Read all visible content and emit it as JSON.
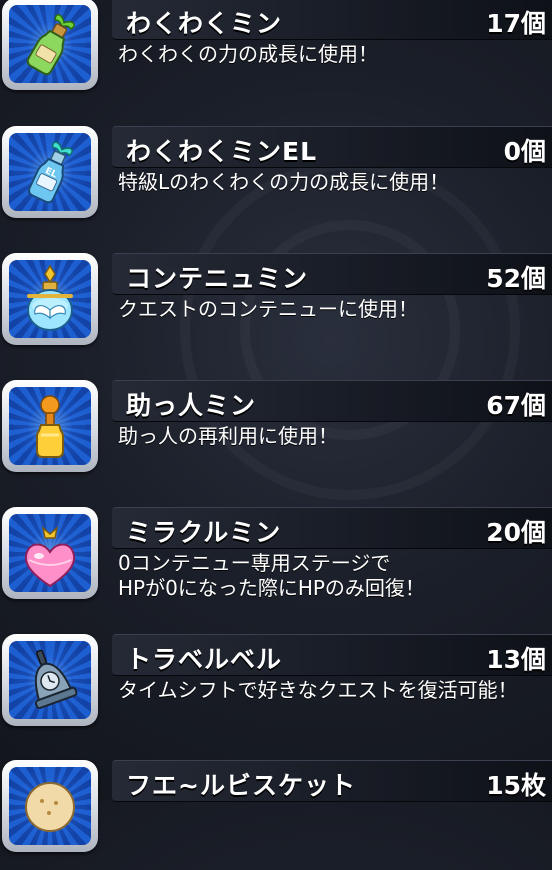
{
  "items": [
    {
      "name": "わくわくミン",
      "count": "17個",
      "desc": [
        "わくわくの力の成長に使用！"
      ],
      "icon": "green-bottle-icon"
    },
    {
      "name": "わくわくミンEL",
      "count": "0個",
      "desc": [
        "特級Lのわくわくの力の成長に使用！"
      ],
      "icon": "el-bottle-icon"
    },
    {
      "name": "コンテニュミン",
      "count": "52個",
      "desc": [
        "クエストのコンテニューに使用！"
      ],
      "icon": "winged-potion-icon"
    },
    {
      "name": "助っ人ミン",
      "count": "67個",
      "desc": [
        "助っ人の再利用に使用！"
      ],
      "icon": "orange-bottle-icon"
    },
    {
      "name": "ミラクルミン",
      "count": "20個",
      "desc": [
        "0コンテニュー専用ステージで",
        "HPが0になった際にHPのみ回復！"
      ],
      "icon": "heart-potion-icon"
    },
    {
      "name": "トラベルベル",
      "count": "13個",
      "desc": [
        "タイムシフトで好きなクエストを復活可能！"
      ],
      "icon": "bell-icon"
    },
    {
      "name": "フエ~ルビスケット",
      "count": "15枚",
      "desc": [],
      "icon": "biscuit-icon"
    }
  ],
  "colors": {
    "panel_blue": "#1d5fd0",
    "text": "#ffffff"
  }
}
